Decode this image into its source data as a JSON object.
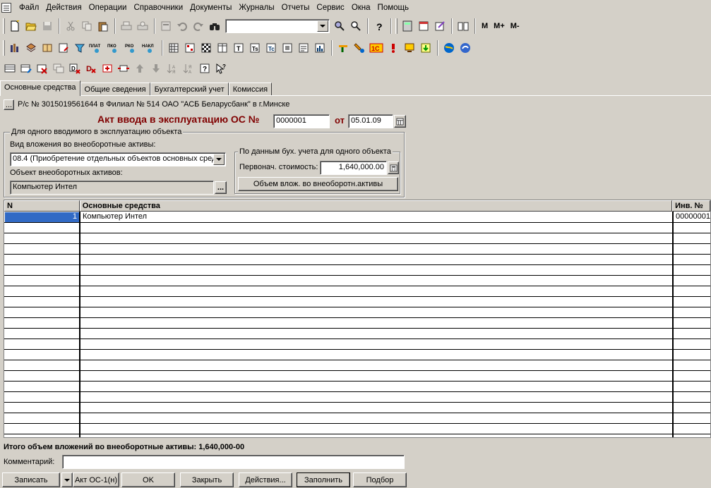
{
  "menu": [
    "Файл",
    "Действия",
    "Операции",
    "Справочники",
    "Документы",
    "Журналы",
    "Отчеты",
    "Сервис",
    "Окна",
    "Помощь"
  ],
  "toolbar": {
    "m": "M",
    "mplus": "M+",
    "mminus": "M-",
    "search_value": "",
    "report_icons": {
      "plat": "ПЛАТ",
      "pko": "ПКО",
      "rko": "РКО",
      "nakl": "НАКЛ"
    },
    "icons": [
      "new-document-icon",
      "open-folder-icon",
      "save-icon",
      "cut-icon",
      "copy-icon",
      "paste-icon",
      "print-icon",
      "print-preview-icon",
      "properties-icon",
      "undo-icon",
      "redo-icon",
      "binoculars-icon",
      "search-icon",
      "search-next-icon",
      "help-icon",
      "calculator-icon",
      "calendar-icon",
      "notes-icon",
      "book-icon"
    ]
  },
  "tabs": [
    "Основные средства",
    "Общие сведения",
    "Бухгалтерский учет",
    "Комиссия"
  ],
  "account": {
    "button": "...",
    "text": "Р/с № 3015019561644 в Филиал № 514 ОАО \"АСБ Беларусбанк\" в г.Минске"
  },
  "doc": {
    "title": "Акт ввода в эксплуатацию ОС №",
    "number": "0000001",
    "date_label": "от",
    "date": "05.01.09"
  },
  "single_object": {
    "legend": "Для одного вводимого в эксплуатацию объекта",
    "investment_type_label": "Вид вложения во внеоборотные активы:",
    "investment_type_value": "08.4 (Приобретение отдельных объектов основных сред",
    "object_label": "Объект внеоборотных активов:",
    "object_value": "Компьютер Интел",
    "object_button": "..."
  },
  "accounting": {
    "legend": "По данным бух. учета для одного объекта",
    "cost_label": "Первонач. стоимость:",
    "cost_value": "1,640,000.00",
    "volume_button": "Объем влож. во внеоборотн.активы"
  },
  "table": {
    "columns": [
      "N",
      "Основные средства",
      "Инв. №"
    ],
    "rows": [
      {
        "n": "1",
        "name": "Компьютер Интел",
        "inv": "00000001"
      }
    ]
  },
  "total": "Итого объем вложений во внеоборотные активы: 1,640,000-00",
  "comment": {
    "label": "Комментарий:",
    "value": ""
  },
  "buttons": {
    "write": "Записать",
    "act": "Акт ОС-1(н)",
    "ok": "OK",
    "close": "Закрыть",
    "actions": "Действия...",
    "fill": "Заполнить",
    "select": "Подбор"
  }
}
